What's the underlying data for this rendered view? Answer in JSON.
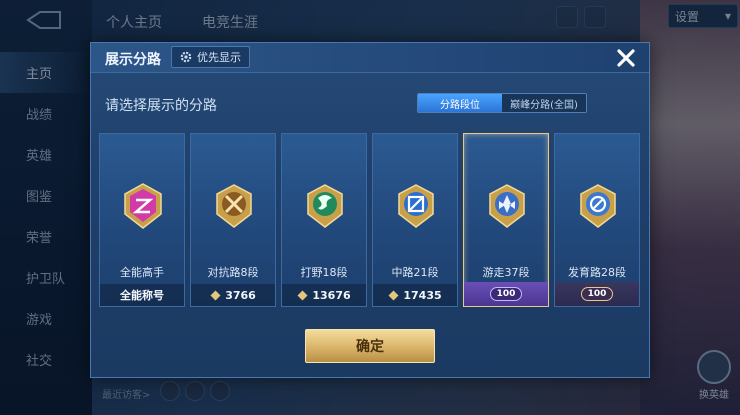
{
  "app": {
    "top_tabs": [
      "个人主页",
      "电竞生涯"
    ],
    "settings_label": "设置",
    "side_nav": [
      "主页",
      "战绩",
      "英雄",
      "图鉴",
      "荣誉",
      "护卫队",
      "游戏",
      "社交"
    ],
    "footer_visitors_label": "最近访客>",
    "swap_hero_label": "换英雄"
  },
  "dialog": {
    "title": "展示分路",
    "priority_label": "优先显示",
    "subtitle": "请选择展示的分路",
    "toggle_options": [
      "分路段位",
      "巅峰分路(全国)"
    ],
    "toggle_selected": 0,
    "confirm_label": "确定",
    "cards": [
      {
        "name": "全能高手",
        "bottom_text": "全能称号",
        "badge_color": "#d23aa8",
        "icon": "allround-icon",
        "selected": false
      },
      {
        "name": "对抗路8段",
        "bottom_text": "3766",
        "badge_color": "#b47b2a",
        "icon": "clash-lane-icon",
        "selected": false
      },
      {
        "name": "打野18段",
        "bottom_text": "13676",
        "badge_color": "#1f8a5c",
        "icon": "jungle-icon",
        "selected": false
      },
      {
        "name": "中路21段",
        "bottom_text": "17435",
        "badge_color": "#2a6fd0",
        "icon": "mid-lane-icon",
        "selected": false
      },
      {
        "name": "游走37段",
        "tier": "100",
        "badge_color": "#3b6fc6",
        "icon": "roam-icon",
        "selected": true
      },
      {
        "name": "发育路28段",
        "tier": "100",
        "badge_color": "#3b78d0",
        "icon": "farm-lane-icon",
        "selected": false
      }
    ]
  },
  "colors": {
    "gold": "#e7c989",
    "panel": "#224a7a",
    "accent_blue": "#4aa3ff"
  }
}
